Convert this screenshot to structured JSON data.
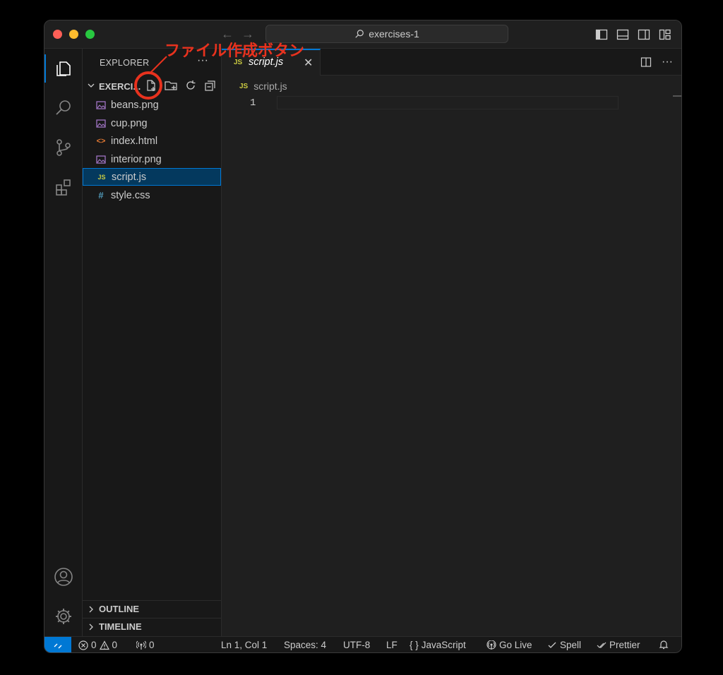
{
  "window": {
    "search_text": "exercises-1"
  },
  "sidebar": {
    "title": "EXPLORER",
    "more": "···",
    "folder_name": "EXERCI...",
    "files": [
      {
        "label": "beans.png",
        "icon": "image-icon",
        "color": "#a074c4"
      },
      {
        "label": "cup.png",
        "icon": "image-icon",
        "color": "#a074c4"
      },
      {
        "label": "index.html",
        "icon": "html-icon",
        "color": "#e37933"
      },
      {
        "label": "interior.png",
        "icon": "image-icon",
        "color": "#a074c4"
      },
      {
        "label": "script.js",
        "icon": "js-icon",
        "color": "#cbcb41",
        "selected": true
      },
      {
        "label": "style.css",
        "icon": "css-icon",
        "color": "#519aba"
      }
    ],
    "icon_glyphs": {
      "js": "JS",
      "css": "#",
      "html": "<>"
    },
    "panels": [
      "OUTLINE",
      "TIMELINE"
    ]
  },
  "editor": {
    "tab_label": "script.js",
    "tab_badge": "JS",
    "breadcrumb_badge": "JS",
    "breadcrumb": "script.js",
    "line_number": "1"
  },
  "statusbar": {
    "errors": "0",
    "warnings": "0",
    "ports": "0",
    "position": "Ln 1, Col 1",
    "spaces": "Spaces: 4",
    "encoding": "UTF-8",
    "eol": "LF",
    "language": "JavaScript",
    "golive": "Go Live",
    "spell": "Spell",
    "prettier": "Prettier"
  },
  "annotation": {
    "text": "ファイル作成ボタン",
    "color": "#e8321e"
  },
  "colors": {
    "accent": "#0078d4",
    "background": "#1f1f1f",
    "sidebar": "#181818"
  }
}
